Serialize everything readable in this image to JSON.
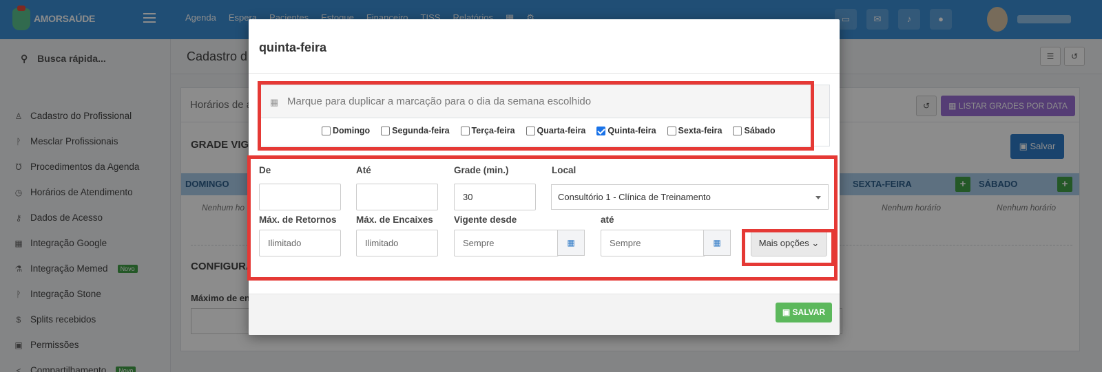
{
  "app": {
    "brand": "AMORSAÚDE",
    "nav": [
      "Agenda",
      "Espera",
      "Pacientes",
      "Estoque",
      "Financeiro",
      "TISS",
      "Relatórios"
    ]
  },
  "sidebar": {
    "search_label": "Busca rápida...",
    "items": [
      {
        "label": "Cadastro do Profissional",
        "icon": "user-icon"
      },
      {
        "label": "Mesclar Profissionais",
        "icon": "merge-icon"
      },
      {
        "label": "Procedimentos da Agenda",
        "icon": "stethoscope-icon"
      },
      {
        "label": "Horários de Atendimento",
        "icon": "clock-icon"
      },
      {
        "label": "Dados de Acesso",
        "icon": "key-icon"
      },
      {
        "label": "Integração Google",
        "icon": "calendar-icon"
      },
      {
        "label": "Integração Memed",
        "icon": "flask-icon",
        "badge": "Novo"
      },
      {
        "label": "Integração Stone",
        "icon": "merge-icon"
      },
      {
        "label": "Splits recebidos",
        "icon": "dollar-icon"
      },
      {
        "label": "Permissões",
        "icon": "lock-icon"
      },
      {
        "label": "Compartilhamento",
        "icon": "share-icon",
        "badge": "Novo"
      }
    ]
  },
  "page": {
    "title": "Cadastro d",
    "card_title": "Horários de a",
    "listar_label": "LISTAR GRADES POR DATA",
    "salvar_label": "Salvar",
    "grade_title": "GRADE VIG",
    "days": {
      "domingo": "DOMINGO",
      "sexta": "SEXTA-FEIRA",
      "sabado": "SÁBADO"
    },
    "nenhum": "Nenhum horário",
    "nenhum_short": "Nenhum ho",
    "config_title": "CONFIGURA",
    "max_label": "Máximo de en"
  },
  "modal": {
    "title": "quinta-feira",
    "duplicate_prompt": "Marque para duplicar a marcação para o dia da semana escolhido",
    "weekdays": [
      {
        "label": "Domingo",
        "checked": false
      },
      {
        "label": "Segunda-feira",
        "checked": false
      },
      {
        "label": "Terça-feira",
        "checked": false
      },
      {
        "label": "Quarta-feira",
        "checked": false
      },
      {
        "label": "Quinta-feira",
        "checked": true
      },
      {
        "label": "Sexta-feira",
        "checked": false
      },
      {
        "label": "Sábado",
        "checked": false
      }
    ],
    "form": {
      "de_label": "De",
      "ate_label": "Até",
      "grade_label": "Grade (min.)",
      "grade_value": "30",
      "local_label": "Local",
      "local_value": "Consultório 1 - Clínica de Treinamento",
      "max_retornos_label": "Máx. de Retornos",
      "max_retornos_placeholder": "Ilimitado",
      "max_encaixes_label": "Máx. de Encaixes",
      "max_encaixes_placeholder": "Ilimitado",
      "vigente_label": "Vigente desde",
      "vigente_placeholder": "Sempre",
      "ate2_label": "até",
      "ate2_placeholder": "Sempre",
      "mais_opcoes": "Mais opções"
    },
    "save_label": "SALVAR"
  },
  "colors": {
    "topbar": "#3b8fd6",
    "annotation_red": "#e53935",
    "save_green": "#5cb85c",
    "listar_purple": "#9c6fd6"
  }
}
